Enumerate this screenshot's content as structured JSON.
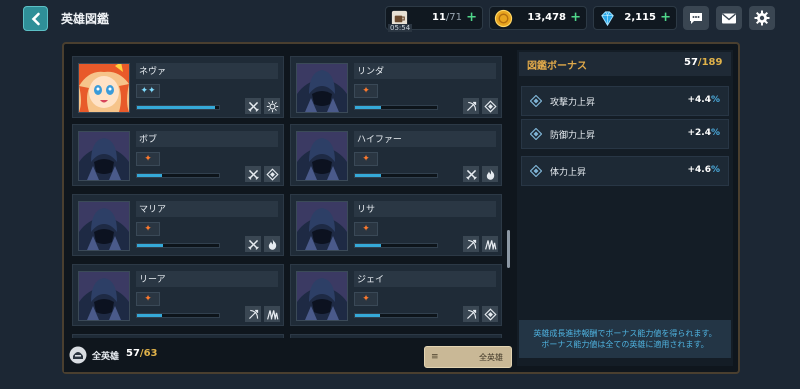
{
  "header": {
    "title": "英雄図鑑",
    "stamina": {
      "current": "11",
      "max": "/71",
      "timer": "05:54"
    },
    "gold": {
      "value": "13,478"
    },
    "gems": {
      "value": "2,115"
    }
  },
  "heroes": [
    {
      "name": "ネヴァ",
      "element": "wind",
      "element_glyph": "✦✦",
      "progress": 0.95,
      "class_icon": "sword-icon",
      "role_icon": "sun-icon"
    },
    {
      "name": "リンダ",
      "element": "fire",
      "element_glyph": "✦",
      "progress": 0.32,
      "class_icon": "bow-icon",
      "role_icon": "diamond-icon"
    },
    {
      "name": "ボブ",
      "element": "fire",
      "element_glyph": "✦",
      "progress": 0.3,
      "class_icon": "sword-icon",
      "role_icon": "diamond-icon"
    },
    {
      "name": "ハイファー",
      "element": "fire",
      "element_glyph": "✦",
      "progress": 0.32,
      "class_icon": "sword-icon",
      "role_icon": "flame-icon"
    },
    {
      "name": "マリア",
      "element": "fire",
      "element_glyph": "✦",
      "progress": 0.32,
      "class_icon": "sword-icon",
      "role_icon": "flame-icon"
    },
    {
      "name": "リサ",
      "element": "fire",
      "element_glyph": "✦",
      "progress": 0.32,
      "class_icon": "bow-icon",
      "role_icon": "claw-icon"
    },
    {
      "name": "リーア",
      "element": "fire",
      "element_glyph": "✦",
      "progress": 0.3,
      "class_icon": "bow-icon",
      "role_icon": "claw-icon"
    },
    {
      "name": "ジェイ",
      "element": "fire",
      "element_glyph": "✦",
      "progress": 0.3,
      "class_icon": "bow-icon",
      "role_icon": "diamond-icon"
    }
  ],
  "footer": {
    "all_heroes_label": "全英雄",
    "owned": "57",
    "total": "/63",
    "filter_label": "全英雄"
  },
  "bonus": {
    "title": "図鑑ボーナス",
    "current": "57",
    "max": "/189",
    "stats": [
      {
        "label": "攻撃力上昇",
        "value": "+4.4",
        "unit": "%"
      },
      {
        "label": "防御力上昇",
        "value": "+2.4",
        "unit": "%"
      },
      {
        "label": "体力上昇",
        "value": "+4.6",
        "unit": "%"
      }
    ],
    "note_line1": "英雄成長進捗報酬でボーナス能力値を得られます。",
    "note_line2": "ボーナス能力値は全ての英雄に適用されます。"
  },
  "colors": {
    "accent_gold": "#e0b24a",
    "progress_blue": "#35a9d8",
    "fire": "#ff7a2e",
    "wind": "#7fdcff",
    "plus_green": "#4fd68a"
  }
}
